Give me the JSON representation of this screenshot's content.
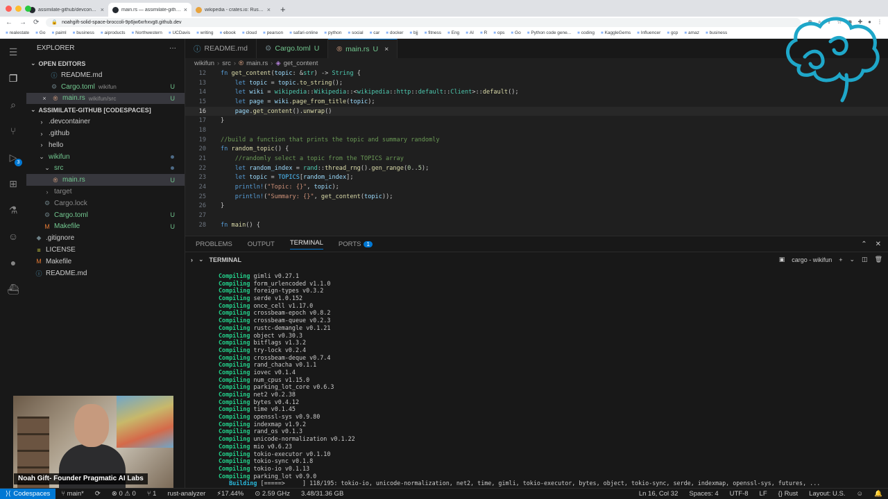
{
  "browser": {
    "tabs": [
      {
        "title": "assimilate-github/devcontain",
        "active": false
      },
      {
        "title": "main.rs — assimilate-github [C",
        "active": true
      },
      {
        "title": "wikipedia - crates.io: Rust Pack",
        "active": false
      }
    ],
    "new_tab": "+",
    "url": "noahgift-solid-space-broccoli-9p6jw6xrhxvg8.github.dev",
    "bookmarks": [
      "realestate",
      "Go",
      "paiml",
      "business",
      "aiproducts",
      "Northwestern",
      "UCDavis",
      "writing",
      "ebook",
      "cloud",
      "pearson",
      "safari-online",
      "python",
      "social",
      "car",
      "docker",
      "bjj",
      "fitness",
      "Eng",
      "AI",
      "R",
      "ops",
      "Go",
      "Python code gene...",
      "coding",
      "KaggleGems",
      "Influencer",
      "gcp",
      "amaz",
      "business"
    ]
  },
  "activity": {
    "source_control_badge": "3"
  },
  "explorer": {
    "title": "EXPLORER",
    "menu": "···",
    "open_editors_label": "OPEN EDITORS",
    "open_editors": [
      {
        "name": "README.md",
        "desc": "",
        "git": ""
      },
      {
        "name": "Cargo.toml",
        "desc": "wikifun",
        "git": "U"
      },
      {
        "name": "main.rs",
        "desc": "wikifun/src",
        "git": "U"
      }
    ],
    "workspace_label": "ASSIMILATE-GITHUB [CODESPACES]",
    "tree": [
      {
        "name": ".devcontainer"
      },
      {
        "name": ".github"
      },
      {
        "name": "hello"
      },
      {
        "name": "wikifun"
      },
      {
        "name": "src"
      },
      {
        "name": "main.rs",
        "git": "U"
      },
      {
        "name": "target"
      },
      {
        "name": "Cargo.lock"
      },
      {
        "name": "Cargo.toml",
        "git": "U"
      },
      {
        "name": "Makefile",
        "git": "U"
      },
      {
        "name": ".gitignore"
      },
      {
        "name": "LICENSE"
      },
      {
        "name": "Makefile"
      },
      {
        "name": "README.md"
      }
    ]
  },
  "webcam": {
    "caption": "Noah Gift- Founder Pragmatic AI Labs"
  },
  "editor": {
    "tabs": [
      {
        "label": "README.md",
        "git": ""
      },
      {
        "label": "Cargo.toml",
        "git": "U"
      },
      {
        "label": "main.rs",
        "git": "U",
        "close": "×"
      }
    ],
    "breadcrumb": [
      "wikifun",
      "src",
      "main.rs",
      "get_content"
    ],
    "line_numbers": [
      "12",
      "13",
      "14",
      "15",
      "16",
      "17",
      "18",
      "19",
      "20",
      "21",
      "22",
      "23",
      "24",
      "25",
      "26",
      "27",
      "28"
    ],
    "lines": [
      "fn get_content(topic: &str) -> String {",
      "    let topic = topic.to_string();",
      "    let wiki = wikipedia::Wikipedia::<wikipedia::http::default::Client>::default();",
      "    let page = wiki.page_from_title(topic);",
      "    page.get_content().unwrap()",
      "}",
      "",
      "//build a function that prints the topic and summary randomly",
      "fn random_topic() {",
      "    //randomly select a topic from the TOPICS array",
      "    let random_index = rand::thread_rng().gen_range(0..5);",
      "    let topic = TOPICS[random_index];",
      "    println!(\"Topic: {}\", topic);",
      "    println!(\"Summary: {}\", get_content(topic));",
      "}",
      "",
      "fn main() {"
    ]
  },
  "panel": {
    "tabs": [
      "PROBLEMS",
      "OUTPUT",
      "TERMINAL",
      "PORTS"
    ],
    "ports_badge": "1",
    "terminal_label": "TERMINAL",
    "terminal_name": "cargo - wikifun",
    "compiling_word": "Compiling",
    "building_word": "Building",
    "crates": [
      "gimli v0.27.1",
      "form_urlencoded v1.1.0",
      "foreign-types v0.3.2",
      "serde v1.0.152",
      "once_cell v1.17.0",
      "crossbeam-epoch v0.8.2",
      "crossbeam-queue v0.2.3",
      "rustc-demangle v0.1.21",
      "object v0.30.3",
      "bitflags v1.3.2",
      "try-lock v0.2.4",
      "crossbeam-deque v0.7.4",
      "rand_chacha v0.1.1",
      "iovec v0.1.4",
      "num_cpus v1.15.0",
      "parking_lot_core v0.6.3",
      "net2 v0.2.38",
      "bytes v0.4.12",
      "time v0.1.45",
      "openssl-sys v0.9.80",
      "indexmap v1.9.2",
      "rand_os v0.1.3",
      "unicode-normalization v0.1.22",
      "mio v0.6.23",
      "tokio-executor v0.1.10",
      "tokio-sync v0.1.8",
      "tokio-io v0.1.13",
      "parking_lot v0.9.0"
    ],
    "building_status": "[=====>     ] 118/195: tokio-io, unicode-normalization, net2, time, gimli, tokio-executor, bytes, object, tokio-sync, serde, indexmap, openssl-sys, futures, ..."
  },
  "statusbar": {
    "remote": "Codespaces",
    "branch": "main*",
    "sync": "⟳",
    "errors": "⊗ 0 ⚠ 0",
    "ports": "⑂ 1",
    "analyzer": "rust-analyzer",
    "cpu": "17.44%",
    "freq": "2.59 GHz",
    "mem": "3.48/31.36 GB",
    "position": "Ln 16, Col 32",
    "spaces": "Spaces: 4",
    "encoding": "UTF-8",
    "eol": "LF",
    "language": "Rust",
    "layout": "Layout: U.S."
  },
  "colors": {
    "accent": "#0078d4",
    "untracked": "#73c991",
    "logo": "#1fa7c9"
  }
}
